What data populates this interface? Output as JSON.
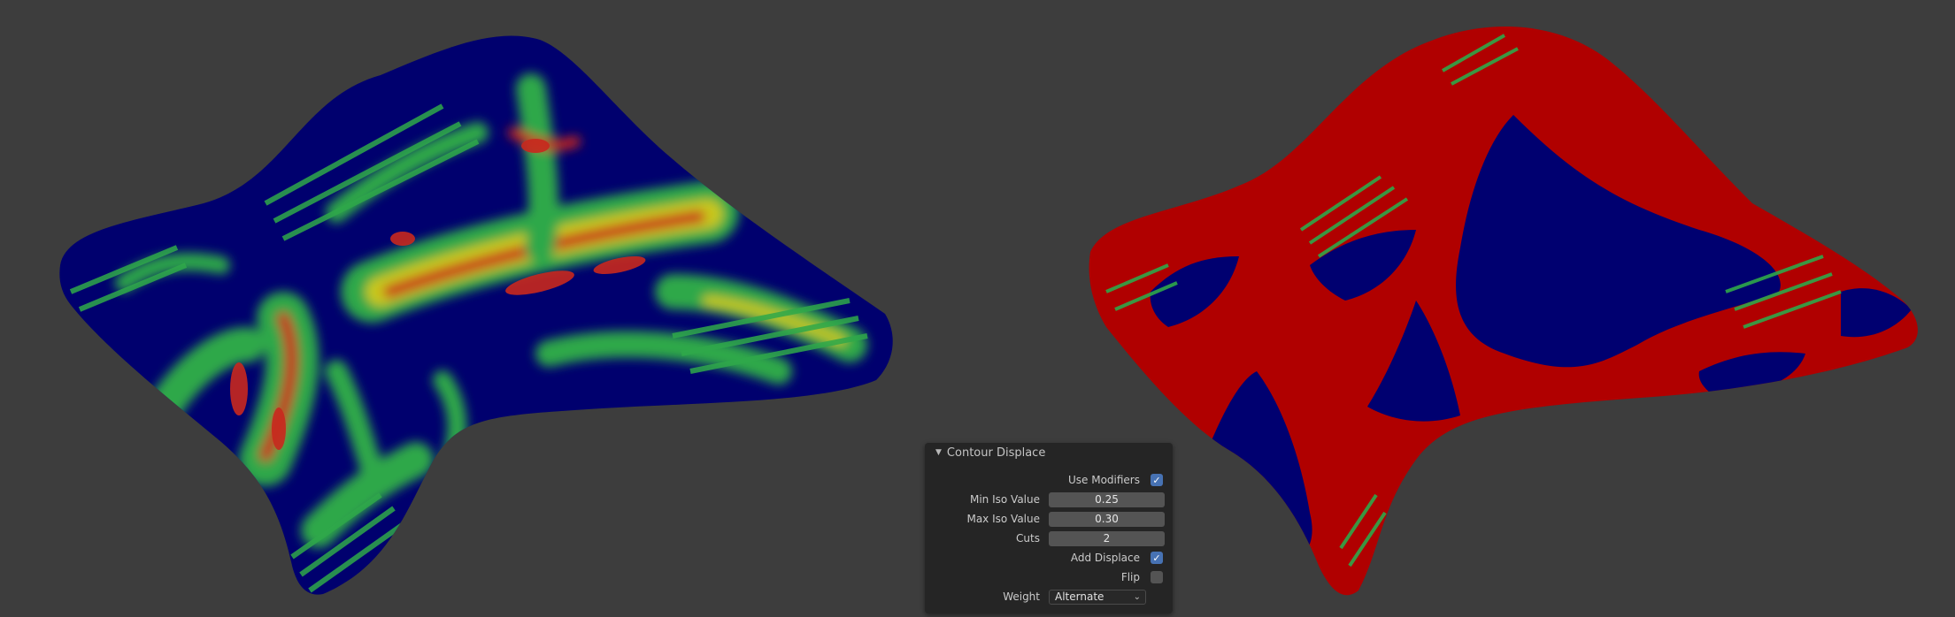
{
  "panel": {
    "title": "Contour Displace",
    "use_modifiers": {
      "label": "Use Modifiers",
      "checked": true
    },
    "min_iso": {
      "label": "Min Iso Value",
      "value": "0.25"
    },
    "max_iso": {
      "label": "Max Iso Value",
      "value": "0.30"
    },
    "cuts": {
      "label": "Cuts",
      "value": "2"
    },
    "add_displace": {
      "label": "Add Displace",
      "checked": true
    },
    "flip": {
      "label": "Flip",
      "checked": false
    },
    "weight": {
      "label": "Weight",
      "value": "Alternate"
    }
  },
  "icons": {
    "collapse": "disclosure-triangle-down-icon",
    "checkbox_tick": "checkmark-icon",
    "dropdown": "chevron-down-icon"
  },
  "colors": {
    "background": "#3d3d3d",
    "panel_bg": "#252525",
    "checkbox_on": "#4772b3",
    "heatmap_low": "#00006e",
    "heatmap_mid": "#2fa84a",
    "heatmap_high": "#c8281e",
    "contour_red": "#b00000",
    "contour_blue": "#000070"
  }
}
